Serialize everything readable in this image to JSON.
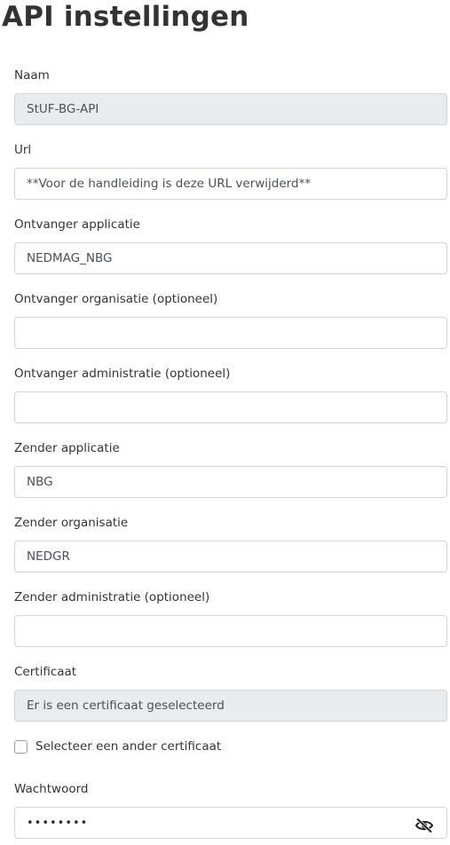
{
  "page": {
    "title": "API instellingen"
  },
  "fields": {
    "naam": {
      "label": "Naam",
      "value": "StUF-BG-API"
    },
    "url": {
      "label": "Url",
      "value": "**Voor de handleiding is deze URL verwijderd**"
    },
    "ontvanger_applicatie": {
      "label": "Ontvanger applicatie",
      "value": "NEDMAG_NBG"
    },
    "ontvanger_organisatie": {
      "label": "Ontvanger organisatie (optioneel)",
      "value": ""
    },
    "ontvanger_administratie": {
      "label": "Ontvanger administratie (optioneel)",
      "value": ""
    },
    "zender_applicatie": {
      "label": "Zender applicatie",
      "value": "NBG"
    },
    "zender_organisatie": {
      "label": "Zender organisatie",
      "value": "NEDGR"
    },
    "zender_administratie": {
      "label": "Zender administratie (optioneel)",
      "value": ""
    },
    "certificaat": {
      "label": "Certificaat",
      "value": "Er is een certificaat geselecteerd"
    },
    "ander_certificaat": {
      "label": "Selecteer een ander certificaat",
      "checked": false
    },
    "wachtwoord": {
      "label": "Wachtwoord",
      "value": "••••••••"
    }
  },
  "icons": {
    "password_toggle": "eye-slash-icon"
  },
  "colors": {
    "disabled_background": "#e9ecef",
    "input_border": "#cfd4d9",
    "text": "#333333"
  }
}
